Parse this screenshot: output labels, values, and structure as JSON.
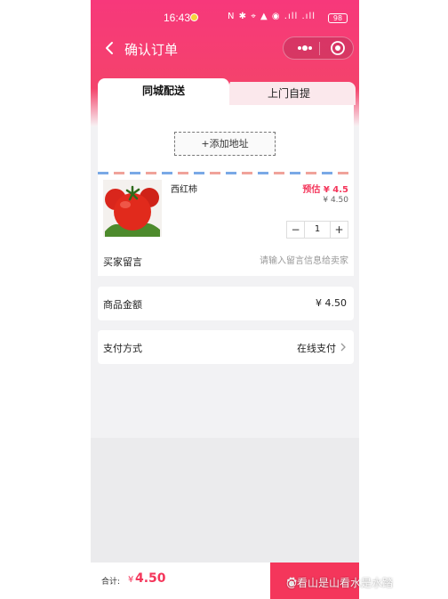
{
  "status_bar": {
    "time": "16:43",
    "icons": "N ✱ ⌖ ▲ ◉ .ıll .ıll",
    "battery": "98"
  },
  "navbar": {
    "title": "确认订单"
  },
  "tabs": [
    {
      "label": "同城配送",
      "active": true
    },
    {
      "label": "上门自提",
      "active": false
    }
  ],
  "address": {
    "add_button": "+添加地址"
  },
  "goods": {
    "name": "西红柿",
    "estimate": "预估 ¥ 4.5",
    "price": "¥ 4.50",
    "quantity": "1",
    "minus": "−",
    "plus": "+"
  },
  "message": {
    "label": "买家留言",
    "placeholder": "请输入留言信息给卖家"
  },
  "amount": {
    "label": "商品金额",
    "value": "¥ 4.50"
  },
  "payment": {
    "label": "支付方式",
    "value": "在线支付"
  },
  "footer": {
    "total_label": "合计:",
    "currency": "¥",
    "total": "4.50",
    "submit_label": ""
  },
  "watermark": "@看山是山看水是水踏",
  "colors": {
    "accent": "#f4365b",
    "header_top": "#f7387b"
  }
}
